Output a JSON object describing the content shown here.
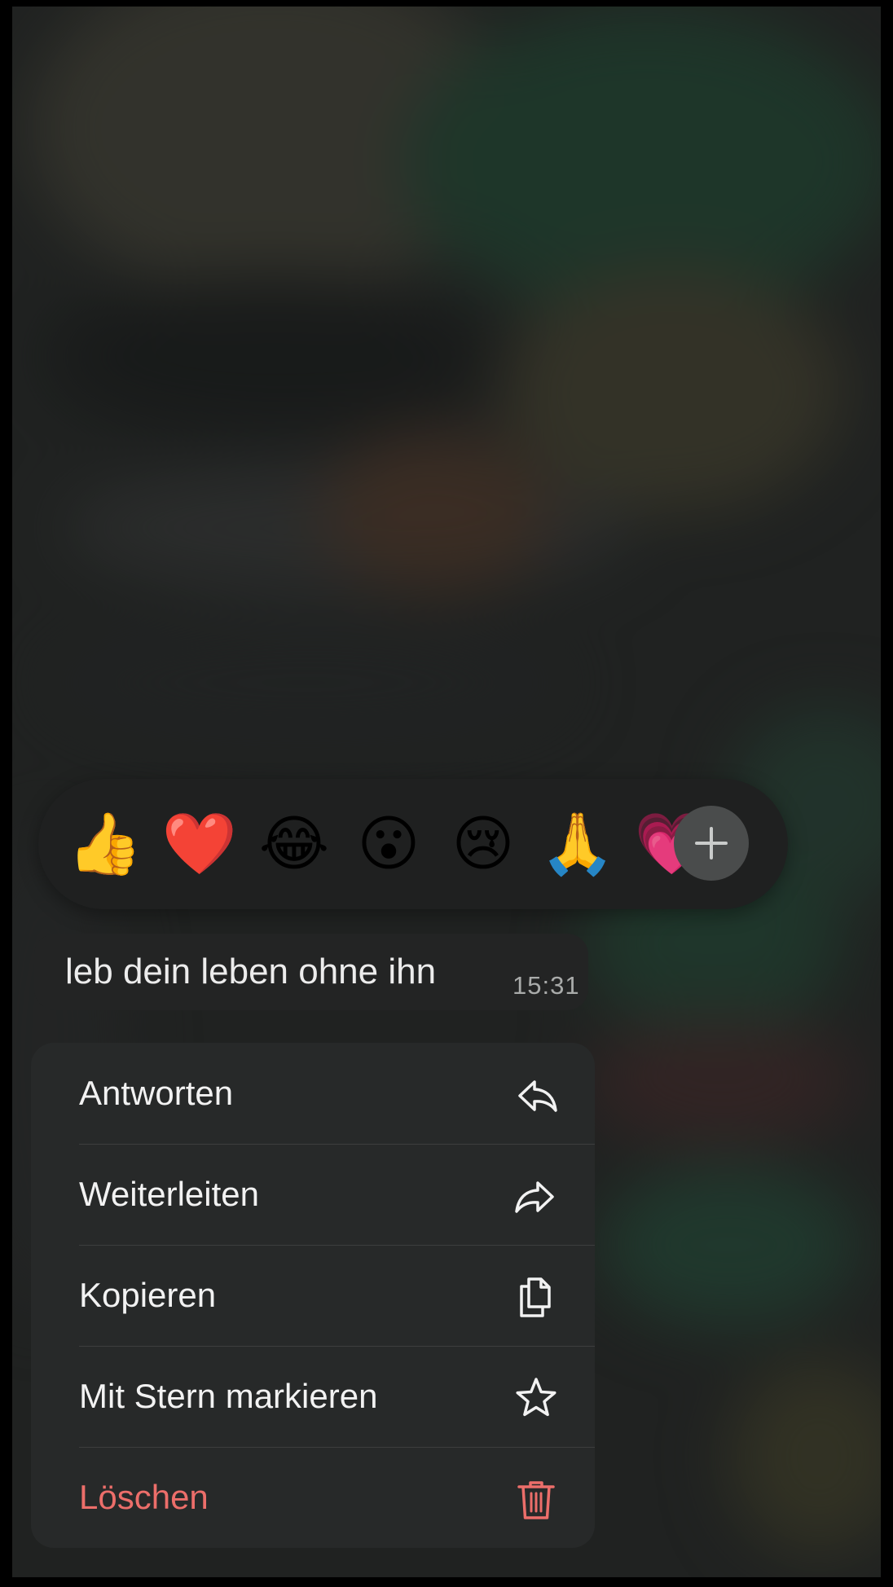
{
  "reactions": {
    "emojis": [
      {
        "icon": "thumbs-up-icon",
        "glyph": "👍"
      },
      {
        "icon": "red-heart-icon",
        "glyph": "❤️"
      },
      {
        "icon": "tears-of-joy-icon",
        "glyph": "😂"
      },
      {
        "icon": "surprised-face-icon",
        "glyph": "😮"
      },
      {
        "icon": "crying-face-icon",
        "glyph": "😢"
      },
      {
        "icon": "folded-hands-icon",
        "glyph": "🙏"
      },
      {
        "icon": "heart-icon",
        "glyph": "💗"
      }
    ],
    "more_icon": "plus-icon"
  },
  "message": {
    "text": "leb dein leben ohne ihn",
    "time": "15:31"
  },
  "menu": {
    "items": [
      {
        "label": "Antworten",
        "icon": "reply-icon"
      },
      {
        "label": "Weiterleiten",
        "icon": "forward-icon"
      },
      {
        "label": "Kopieren",
        "icon": "copy-icon"
      },
      {
        "label": "Mit Stern markieren",
        "icon": "star-icon"
      },
      {
        "label": "Löschen",
        "icon": "trash-icon",
        "color": "#ec6e6a"
      }
    ]
  }
}
